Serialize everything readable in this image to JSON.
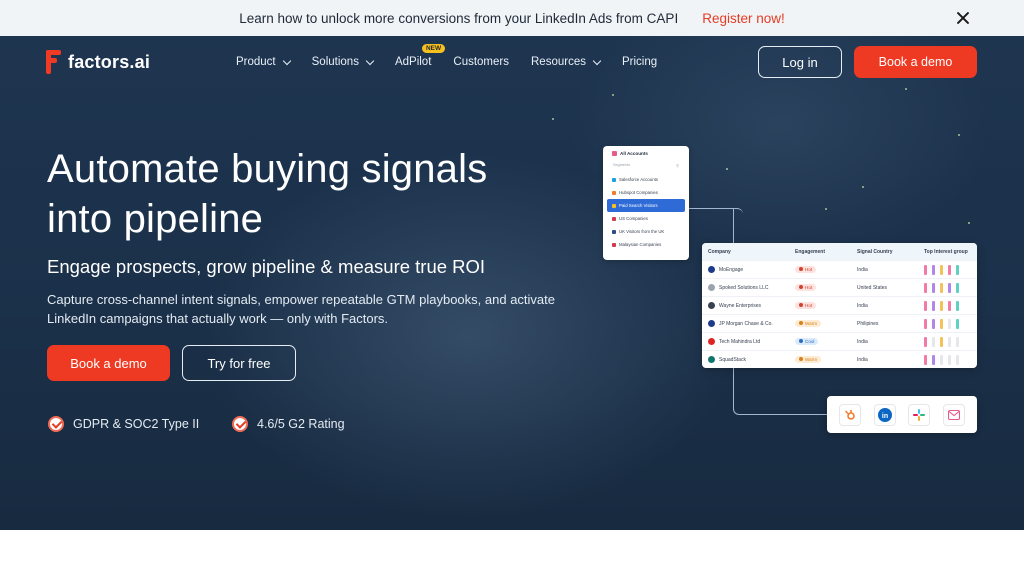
{
  "announcement": {
    "text": "Learn how to unlock more conversions from your LinkedIn Ads from CAPI",
    "link": "Register now!"
  },
  "nav": {
    "logo_text": "factors.ai",
    "items": [
      {
        "label": "Product",
        "dropdown": true
      },
      {
        "label": "Solutions",
        "dropdown": true
      },
      {
        "label": "AdPilot",
        "dropdown": false,
        "badge": "NEW"
      },
      {
        "label": "Customers",
        "dropdown": false
      },
      {
        "label": "Resources",
        "dropdown": true
      },
      {
        "label": "Pricing",
        "dropdown": false
      }
    ],
    "login": "Log in",
    "demo": "Book a demo"
  },
  "hero": {
    "title_line1": "Automate buying signals",
    "title_line2": "into pipeline",
    "subtitle": "Engage prospects, grow pipeline & measure true ROI",
    "description": "Capture cross-channel intent signals, empower repeatable GTM playbooks, and activate LinkedIn campaigns that actually work — only with Factors.",
    "cta_primary": "Book a demo",
    "cta_secondary": "Try for free",
    "trust": [
      "GDPR & SOC2 Type II",
      "4.6/5 G2 Rating"
    ]
  },
  "accounts_panel": {
    "title": "All Accounts",
    "segments_label": "Segments",
    "items": [
      {
        "label": "Salesforce Accounts",
        "color": "#1aa1e0"
      },
      {
        "label": "Hubspot Companies",
        "color": "#f57a2a"
      },
      {
        "label": "Paid Search Visitors",
        "color": "#f6c11e",
        "active": true
      },
      {
        "label": "US Companies",
        "color": "#d33a4a"
      },
      {
        "label": "UK Visitors from the UK",
        "color": "#2e4a8a"
      },
      {
        "label": "Malaysian Companies",
        "color": "#d33a4a"
      }
    ]
  },
  "table_panel": {
    "headers": [
      "Company",
      "Engagement",
      "Signal Country",
      "Top Interest group"
    ],
    "rows": [
      {
        "company": "MoEngage",
        "engagement": "Hot",
        "level": "hot",
        "country": "India",
        "icon": "#1e3a8a"
      },
      {
        "company": "Spoked Solutions LLC",
        "engagement": "Hot",
        "level": "hot",
        "country": "United States",
        "icon": "#9ca3af"
      },
      {
        "company": "Wayne Enterprises",
        "engagement": "Hot",
        "level": "hot",
        "country": "India",
        "icon": "#374151"
      },
      {
        "company": "JP Morgan Chase & Co.",
        "engagement": "Warm",
        "level": "warm",
        "country": "Philipines",
        "icon": "#1e3a8a"
      },
      {
        "company": "Tech Mahindra Ltd",
        "engagement": "Cool",
        "level": "cool",
        "country": "India",
        "icon": "#dc2626"
      },
      {
        "company": "SquadStack",
        "engagement": "Warm",
        "level": "warm",
        "country": "India",
        "icon": "#0f766e"
      }
    ]
  },
  "integrations": [
    {
      "name": "hubspot-icon",
      "color": "#f57a2a"
    },
    {
      "name": "linkedin-icon",
      "color": "#0a66c2"
    },
    {
      "name": "slack-icon",
      "color": "#4a154b"
    },
    {
      "name": "email-icon",
      "color": "#e65b8a"
    }
  ],
  "colors": {
    "accent": "#ee3a22",
    "hero_bg": "#1e3550",
    "announce_bg": "#f1f4f7"
  }
}
